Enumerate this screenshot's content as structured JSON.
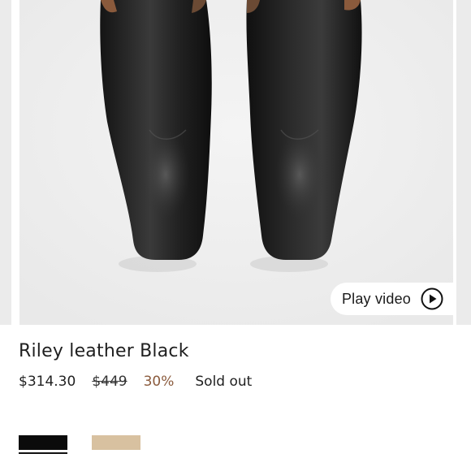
{
  "product": {
    "title": "Riley leather Black",
    "price_current": "$314.30",
    "price_original": "$449",
    "discount": "30%",
    "stock_status": "Sold out"
  },
  "media": {
    "play_video_label": "Play video",
    "play_icon": "play-circle-icon"
  },
  "swatches": [
    {
      "color": "#0b0b0b",
      "selected": true
    },
    {
      "color": "#d8c1a0",
      "selected": false
    }
  ],
  "colors": {
    "discount": "#8a5a3c",
    "background": "#ffffff",
    "image_background": "#efefef"
  }
}
